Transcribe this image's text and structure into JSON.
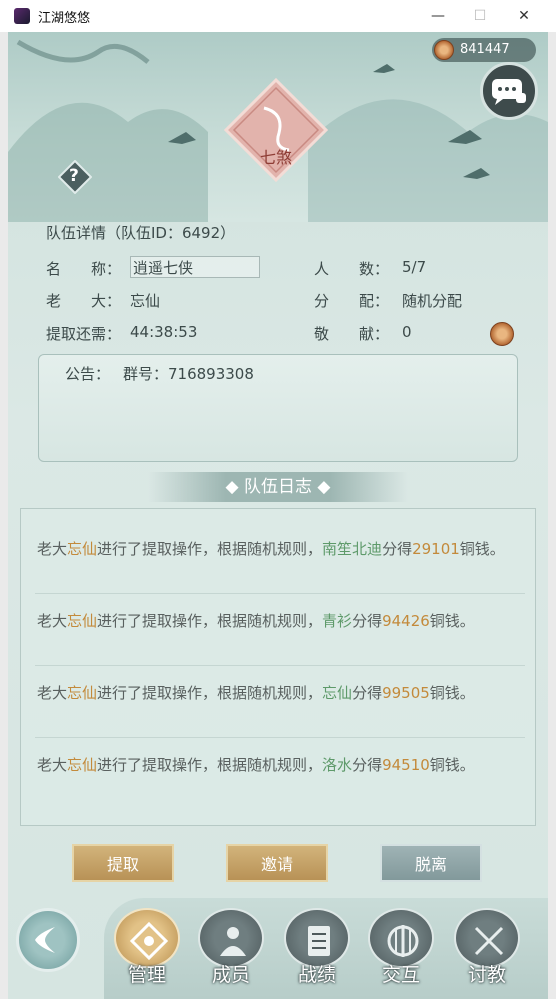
{
  "window": {
    "title": "江湖悠悠",
    "controls": {
      "minimize": "—",
      "maximize": "☐",
      "close": "✕"
    }
  },
  "header": {
    "coins": "841447",
    "emblem_text": "七煞",
    "help": "?"
  },
  "team": {
    "title": "队伍详情（队伍ID：6492）",
    "name_label": "名　　称：",
    "name_value": "逍遥七侠",
    "leader_label": "老　　大：",
    "leader_value": "忘仙",
    "extract_label": "提取还需：",
    "extract_value": "44:38:53",
    "count_label": "人　　数：",
    "count_value": "5/7",
    "distribute_label": "分　　配：",
    "distribute_value": "随机分配",
    "contrib_label": "敬　　献：",
    "contrib_value": "0"
  },
  "notice": {
    "label": "公告：",
    "text": "群号：716893308"
  },
  "log": {
    "title": "◆ 队伍日志 ◆",
    "entries": [
      {
        "prefix": "老大",
        "leader": "忘仙",
        "mid": "进行了提取操作，根据随机规则，",
        "member": "南笙北迪",
        "got": "分得",
        "amount": "29101",
        "suffix": "铜钱。"
      },
      {
        "prefix": "老大",
        "leader": "忘仙",
        "mid": "进行了提取操作，根据随机规则，",
        "member": "青衫",
        "got": "分得",
        "amount": "94426",
        "suffix": "铜钱。"
      },
      {
        "prefix": "老大",
        "leader": "忘仙",
        "mid": "进行了提取操作，根据随机规则，",
        "member": "忘仙",
        "got": "分得",
        "amount": "99505",
        "suffix": "铜钱。"
      },
      {
        "prefix": "老大",
        "leader": "忘仙",
        "mid": "进行了提取操作，根据随机规则，",
        "member": "洛水",
        "got": "分得",
        "amount": "94510",
        "suffix": "铜钱。"
      }
    ]
  },
  "actions": {
    "extract": "提取",
    "invite": "邀请",
    "leave": "脱离"
  },
  "nav": {
    "manage": "管理",
    "members": "成员",
    "record": "战绩",
    "interact": "交互",
    "challenge": "讨教"
  },
  "colors": {
    "gold": "#c38a3b",
    "green": "#5e9a6a",
    "teal": "#d8e6e3"
  },
  "icons": [
    "chat-bubble-icon",
    "help-icon",
    "coin-icon",
    "back-arrow-icon",
    "manage-icon",
    "members-icon",
    "record-icon",
    "interact-icon",
    "challenge-icon"
  ]
}
